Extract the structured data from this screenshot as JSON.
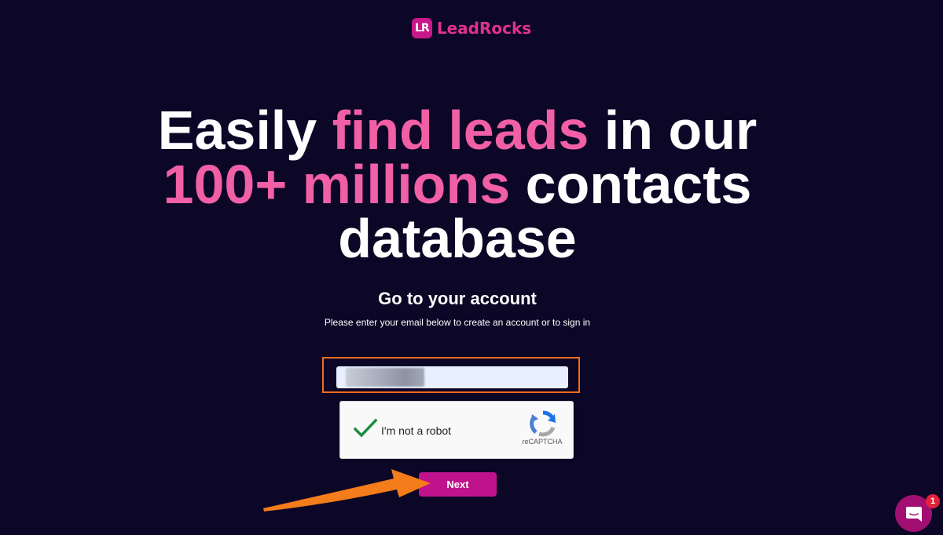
{
  "brand": {
    "logo_mark": "LR",
    "name": "LeadRocks"
  },
  "headline": {
    "part1": "Easily ",
    "part2": "find leads",
    "part3": " in our",
    "part4": "100+ millions",
    "part5": " contacts",
    "part6": "database"
  },
  "account": {
    "title": "Go to your account",
    "subtitle": "Please enter your email below to create an account or to sign in"
  },
  "email": {
    "value": "@gmail.com"
  },
  "captcha": {
    "label": "I'm not a robot",
    "brand": "reCAPTCHA"
  },
  "next": {
    "label": "Next"
  },
  "chat": {
    "badge_count": "1"
  },
  "colors": {
    "background": "#0c0726",
    "accent_pink": "#f15fa6",
    "button": "#c0138b",
    "annotation_orange": "#f47c1b",
    "highlight_border": "#f26b1d"
  },
  "icons": {
    "captcha_check": "check-icon",
    "captcha_logo": "recaptcha-logo-icon",
    "annotation": "arrow-icon",
    "chat": "chat-bubble-icon"
  }
}
